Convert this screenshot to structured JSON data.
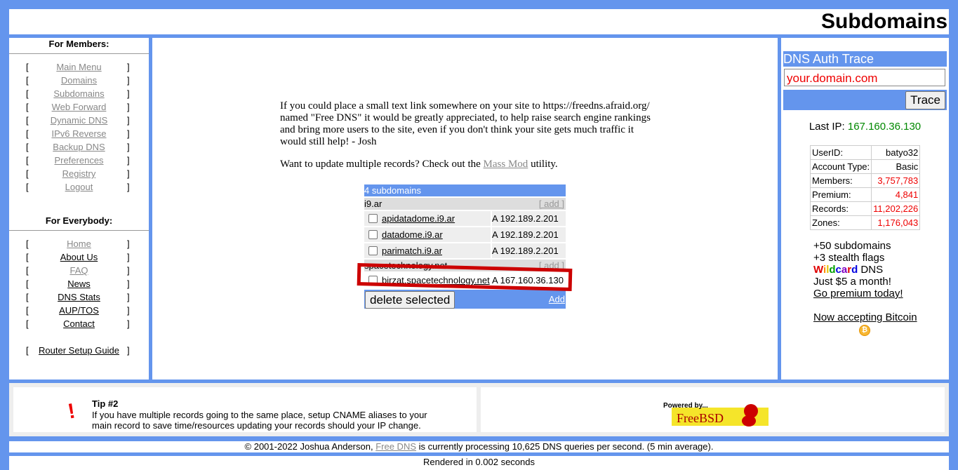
{
  "header": {
    "title": "Subdomains"
  },
  "sidebar": {
    "members_heading": "For Members:",
    "members_items": [
      {
        "label": "Main Menu"
      },
      {
        "label": "Domains"
      },
      {
        "label": "Subdomains"
      },
      {
        "label": "Web Forward"
      },
      {
        "label": "Dynamic DNS"
      },
      {
        "label": "IPv6 Reverse"
      },
      {
        "label": "Backup DNS"
      },
      {
        "label": "Preferences"
      },
      {
        "label": "Registry"
      },
      {
        "label": "Logout"
      }
    ],
    "everybody_heading": "For Everybody:",
    "everybody_items": [
      {
        "label": "Home"
      },
      {
        "label": "About Us"
      },
      {
        "label": "FAQ"
      },
      {
        "label": "News"
      },
      {
        "label": "DNS Stats"
      },
      {
        "label": "AUP/TOS"
      },
      {
        "label": "Contact"
      }
    ],
    "router_guide": "Router Setup Guide",
    "bracket_open": "[",
    "bracket_close": "]"
  },
  "main": {
    "intro": "If you could place a small text link somewhere on your site to https://freedns.afraid.org/ named \"Free DNS\" it would be greatly appreciated, to help raise search engine rankings and bring more users to the site, even if you don't think your site gets much traffic it would still help! - Josh",
    "massmod_prefix": "Want to update multiple records? Check out the",
    "massmod_link": "Mass Mod",
    "massmod_suffix": "utility.",
    "subdomain_count": "4 subdomains",
    "add_label": "[ add ]",
    "groups": [
      {
        "domain": "i9.ar",
        "records": [
          {
            "name": "apidatadome.i9.ar",
            "type": "A",
            "value": "192.189.2.201"
          },
          {
            "name": "datadome.i9.ar",
            "type": "A",
            "value": "192.189.2.201"
          },
          {
            "name": "parimatch.i9.ar",
            "type": "A",
            "value": "192.189.2.201"
          }
        ]
      },
      {
        "domain": "spacetechnology.net",
        "records": [
          {
            "name": "birzat.spacetechnology.net",
            "type": "A",
            "value": "167.160.36.130"
          }
        ]
      }
    ],
    "delete_button": "delete selected",
    "add_link": "Add"
  },
  "right": {
    "trace_title": "DNS Auth Trace",
    "trace_placeholder": "your.domain.com",
    "trace_button": "Trace",
    "last_ip_label": "Last IP:",
    "last_ip": "167.160.36.130",
    "stats": [
      {
        "label": "UserID:",
        "value": "batyo32"
      },
      {
        "label": "Account Type:",
        "value": "Basic"
      },
      {
        "label": "Members:",
        "value": "3,757,783"
      },
      {
        "label": "Premium:",
        "value": "4,841"
      },
      {
        "label": "Records:",
        "value": "11,202,226"
      },
      {
        "label": "Zones:",
        "value": "1,176,043"
      }
    ],
    "promo_line1": "+50 subdomains",
    "promo_line2": "+3 stealth flags",
    "wildcard_word": "Wildcard",
    "promo_dns": "DNS",
    "promo_line4": "Just $5 a month!",
    "promo_link": "Go premium today!",
    "bitcoin_link": "Now accepting Bitcoin",
    "wildcard_colors": [
      "#e00000",
      "#ff8c00",
      "#e6c200",
      "#00a000",
      "#0000e0",
      "#8000c0",
      "#e00000",
      "#0000e0"
    ]
  },
  "footer": {
    "tip_icon": "!",
    "tip_title": "Tip #2",
    "tip_text": "If you have multiple records going to the same place, setup CNAME aliases to your main record to save time/resources updating your records should your IP change.",
    "powered_by": "Powered by...",
    "freebsd": "FreeBSD",
    "copyright_prefix": "© 2001-2022 Joshua Anderson,",
    "copyright_link": "Free DNS",
    "copyright_suffix": "is currently processing 10,625 DNS queries per second. (5 min average).",
    "rendered": "Rendered in 0.002 seconds"
  }
}
